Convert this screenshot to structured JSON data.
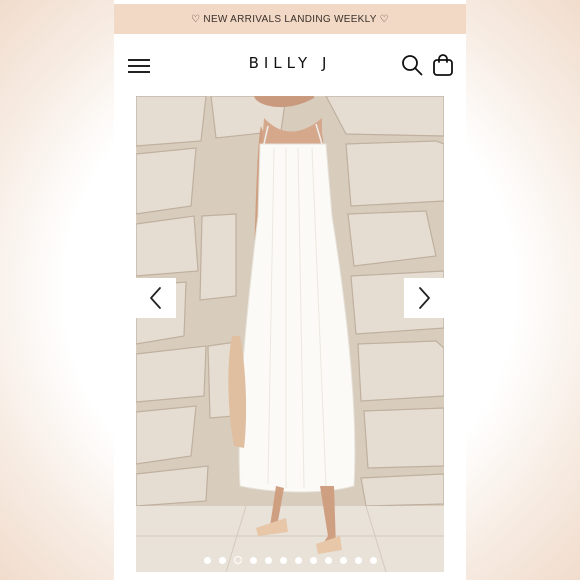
{
  "announcement": {
    "text": "♡ NEW ARRIVALS LANDING WEEKLY ♡"
  },
  "header": {
    "brand": "BILLY J",
    "icons": [
      "menu-icon",
      "search-icon",
      "shopping-bag-icon"
    ]
  },
  "gallery": {
    "slide_count": 12,
    "active_slide": 3,
    "controls": [
      "chevron-left-icon",
      "chevron-right-icon"
    ]
  },
  "colors": {
    "announcement_bg": "#f1d9c5",
    "text": "#111111",
    "page_bg": "#ffffff"
  }
}
